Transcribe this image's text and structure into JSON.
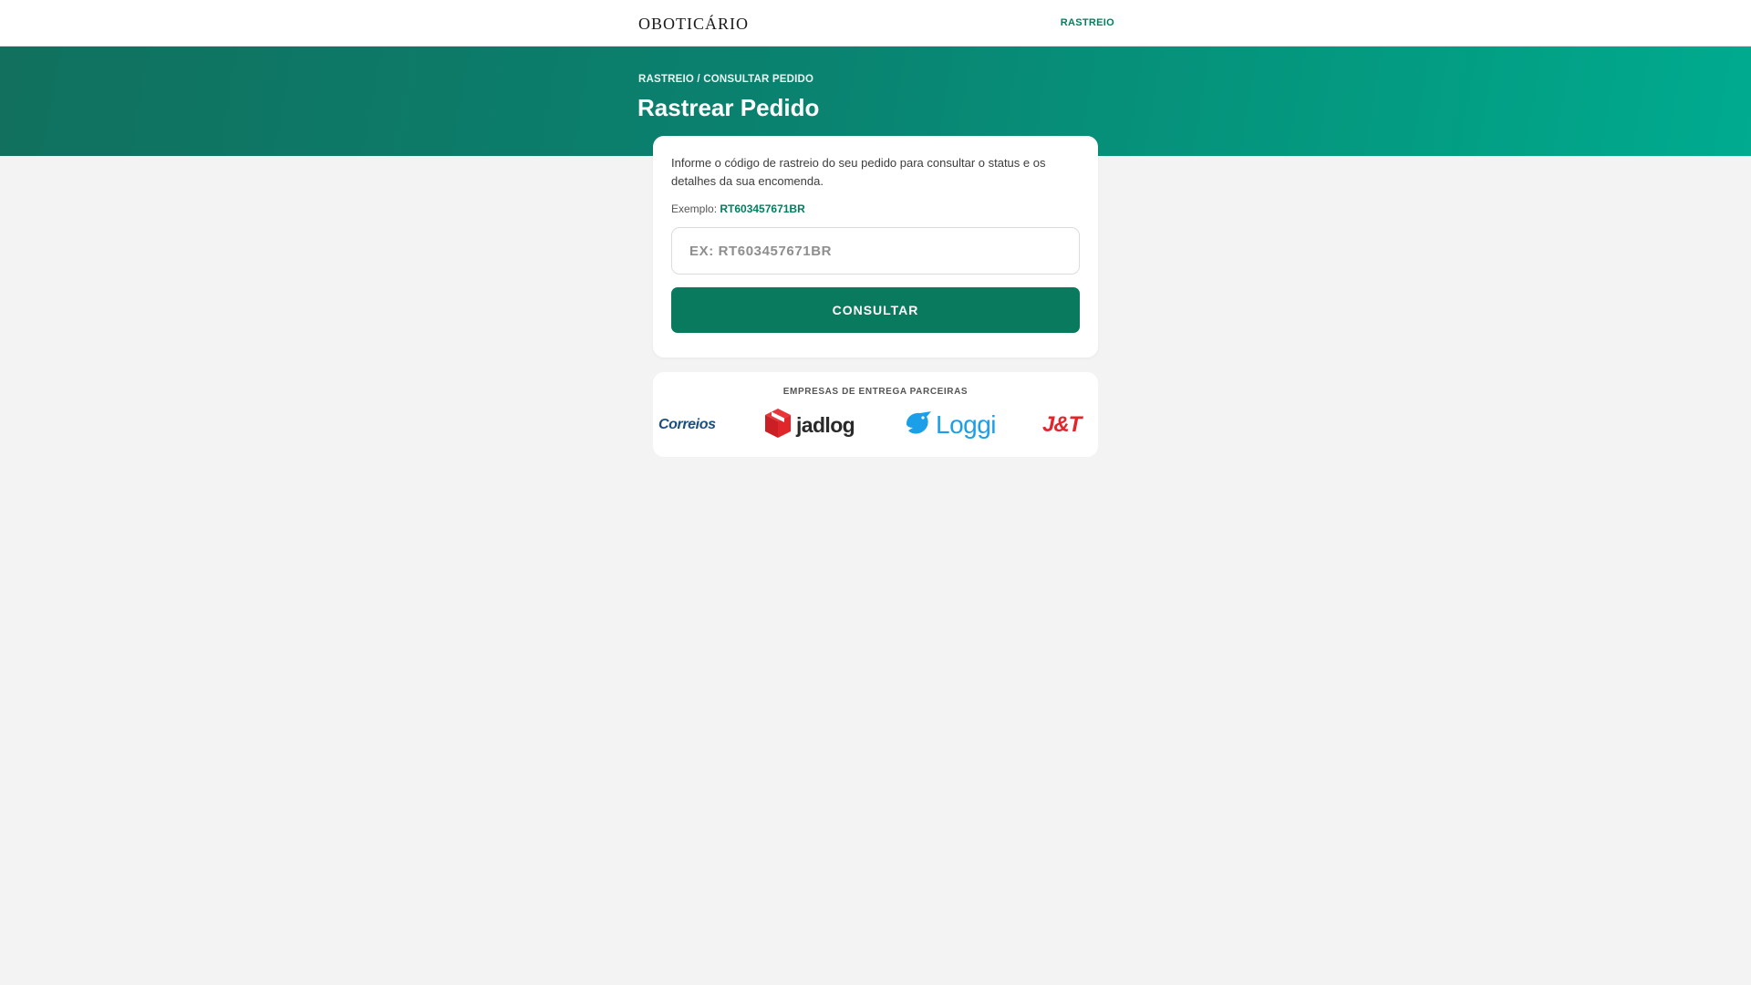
{
  "header": {
    "brand": "oBoticário",
    "nav_label": "RASTREIO"
  },
  "hero": {
    "breadcrumb_root": "RASTREIO",
    "breadcrumb_separator": " / ",
    "breadcrumb_current": "CONSULTAR PEDIDO",
    "title": "Rastrear Pedido"
  },
  "tracking_form": {
    "intro": "Informe o código de rastreio do seu pedido para consultar o status e os detalhes da sua encomenda.",
    "example_label": "Exemplo: ",
    "example_code": "RT603457671BR",
    "input_value": "",
    "input_placeholder": "EX: RT603457671BR",
    "submit_label": "CONSULTAR"
  },
  "partners": {
    "title": "EMPRESAS DE ENTREGA PARCEIRAS",
    "items": [
      {
        "name": "Correios",
        "icon": "correios-logo",
        "color": "#1d4f7c"
      },
      {
        "name": "jadlog",
        "icon": "jadlog-cube-icon",
        "color": "#e0252b"
      },
      {
        "name": "Loggi",
        "icon": "loggi-bird-icon",
        "color": "#1a9fe8"
      },
      {
        "name": "J&T",
        "icon": "jt-logo",
        "color": "#e2262b"
      }
    ]
  },
  "colors": {
    "accent": "#008060",
    "button": "#0a7a5f",
    "hero_start": "#11705e",
    "hero_end": "#00ab8f",
    "background": "#f3f3f3"
  }
}
